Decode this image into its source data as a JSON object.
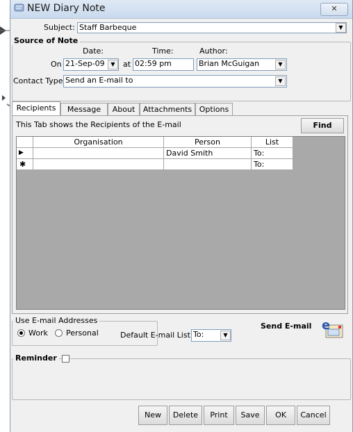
{
  "window": {
    "title": "NEW Diary Note",
    "close_label": "✕"
  },
  "subject": {
    "label": "Subject:",
    "value": "Staff Barbeque"
  },
  "source_of_note": {
    "legend": "Source of Note",
    "date_label": "Date:",
    "time_label": "Time:",
    "author_label": "Author:",
    "on_label": "On",
    "at_label": "at",
    "date_value": "21-Sep-09",
    "time_value": "02:59 pm",
    "author_value": "Brian McGuigan",
    "contact_type_label": "Contact Type:",
    "contact_type_value": "Send an E-mail to"
  },
  "tabs": [
    {
      "label": "Recipients"
    },
    {
      "label": "Message"
    },
    {
      "label": "About"
    },
    {
      "label": "Attachments"
    },
    {
      "label": "Options"
    }
  ],
  "recipients": {
    "info": "This Tab shows the Recipients of the E-mail",
    "find_label": "Find",
    "columns": [
      "Organisation",
      "Person",
      "List"
    ],
    "rows": [
      {
        "marker": "▶",
        "organisation": "",
        "person": "David Smith",
        "list": "To:"
      },
      {
        "marker": "✱",
        "organisation": "",
        "person": "",
        "list": "To:"
      }
    ]
  },
  "email_addresses": {
    "legend": "Use E-mail Addresses",
    "work_label": "Work",
    "personal_label": "Personal",
    "default_list_label": "Default E-mail List",
    "default_list_value": "To:",
    "send_label": "Send E-mail"
  },
  "reminder": {
    "label": "Reminder"
  },
  "buttons": {
    "new": "New",
    "delete": "Delete",
    "print": "Print",
    "save": "Save",
    "ok": "OK",
    "cancel": "Cancel"
  },
  "colors": {
    "grid_background": "#a9a9a9",
    "window_bg": "#f0f0f0",
    "title_bg": "#d6e3f2"
  }
}
